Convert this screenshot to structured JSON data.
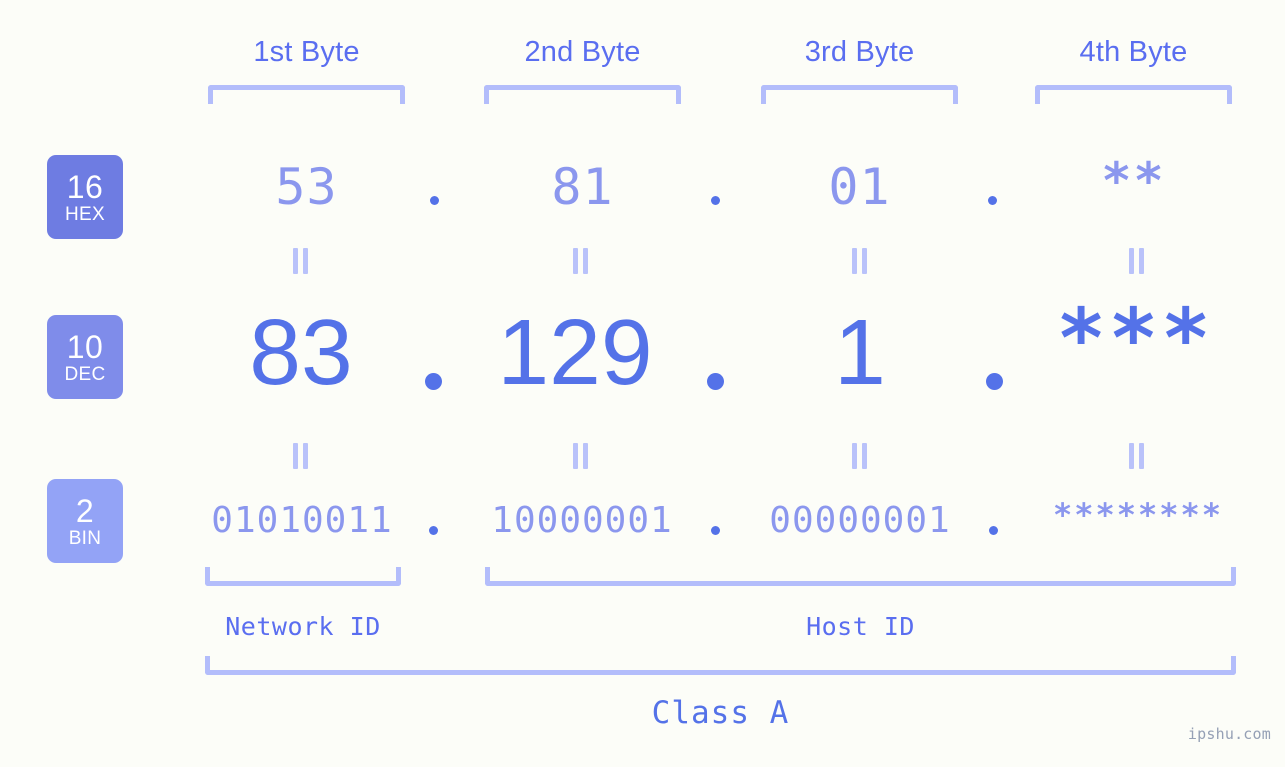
{
  "background_color": "#fcfdf8",
  "accent_color": "#5472e8",
  "accent_light_color": "#8b97ee",
  "bracket_color": "#b3bdfb",
  "byte_headers": [
    {
      "label": "1st Byte"
    },
    {
      "label": "2nd Byte"
    },
    {
      "label": "3rd Byte"
    },
    {
      "label": "4th Byte"
    }
  ],
  "radix_badges": [
    {
      "number": "16",
      "name": "HEX",
      "color": "#6e7ce2"
    },
    {
      "number": "10",
      "name": "DEC",
      "color": "#7f8cea"
    },
    {
      "number": "2",
      "name": "BIN",
      "color": "#93a3f6"
    }
  ],
  "rows": {
    "hex": {
      "radix": "16",
      "radix_name": "HEX",
      "bytes": [
        "53",
        "81",
        "01",
        "**"
      ],
      "separator": "."
    },
    "dec": {
      "radix": "10",
      "radix_name": "DEC",
      "bytes": [
        "83",
        "129",
        "1",
        "***"
      ],
      "separator": "."
    },
    "bin": {
      "radix": "2",
      "radix_name": "BIN",
      "bytes": [
        "01010011",
        "10000001",
        "00000001",
        "********"
      ],
      "separator": "."
    }
  },
  "equality_symbol": "=",
  "segments": {
    "network_id": "Network ID",
    "host_id": "Host ID"
  },
  "class_label": "Class A",
  "watermark": "ipshu.com"
}
